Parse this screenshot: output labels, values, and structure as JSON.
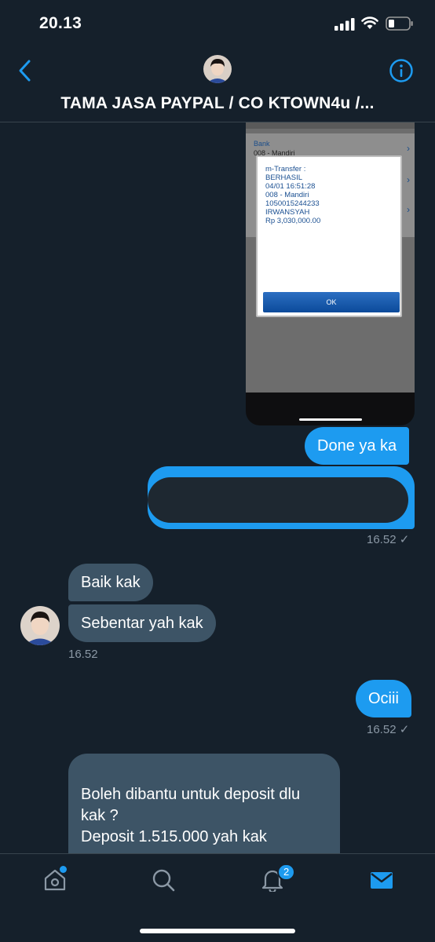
{
  "status_bar": {
    "time": "20.13"
  },
  "header": {
    "title": "TAMA JASA PAYPAL / CO KTOWN4u /...",
    "back_icon": "chevron-left-icon",
    "info_icon": "info-icon"
  },
  "screenshot": {
    "rows": [
      {
        "label": "Bank",
        "value": "008 - Mandiri"
      }
    ],
    "dialog_text": "m-Transfer :\nBERHASIL\n04/01 16:51:28\n008 - Mandiri\n1050015244233\nIRWANSYAH\nRp 3,030,000.00",
    "ok_label": "OK"
  },
  "messages": {
    "m1": {
      "text": "Done ya ka"
    },
    "m2_time": "16.52 ✓",
    "m3": {
      "text": "Baik kak"
    },
    "m4": {
      "text": "Sebentar yah kak"
    },
    "m4_time": "16.52",
    "m5": {
      "text": "Ociii"
    },
    "m5_time": "16.52 ✓",
    "m6": {
      "text": "Boleh dibantu untuk deposit dlu\nkak ?\nDeposit 1.515.000 yah kak"
    }
  },
  "nav": {
    "items": [
      {
        "icon": "home-icon"
      },
      {
        "icon": "search-icon"
      },
      {
        "icon": "bell-icon",
        "badge": "2"
      },
      {
        "icon": "mail-icon"
      }
    ]
  },
  "colors": {
    "background": "#15202b",
    "accent": "#1d9bf0",
    "incoming_bubble": "#3d5466",
    "muted_text": "#8b98a5"
  }
}
